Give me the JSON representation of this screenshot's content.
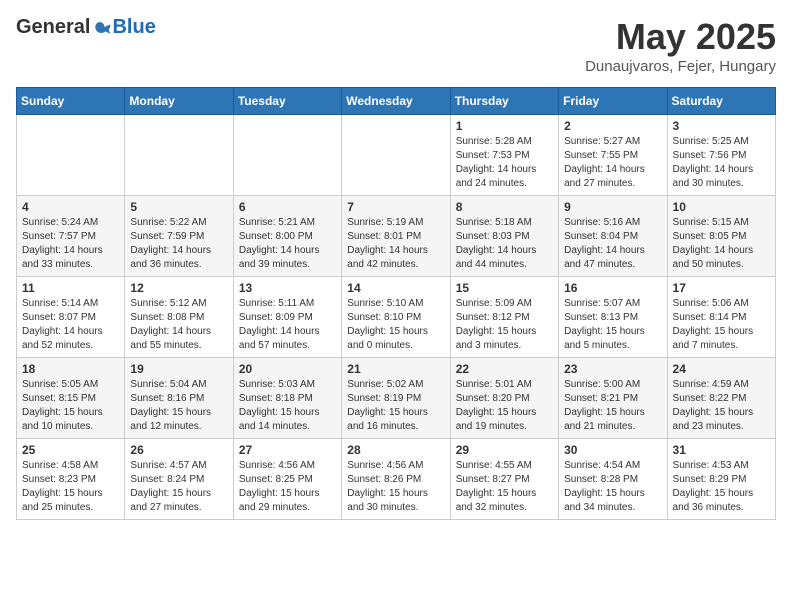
{
  "header": {
    "logo_general": "General",
    "logo_blue": "Blue",
    "title": "May 2025",
    "subtitle": "Dunaujvaros, Fejer, Hungary"
  },
  "weekdays": [
    "Sunday",
    "Monday",
    "Tuesday",
    "Wednesday",
    "Thursday",
    "Friday",
    "Saturday"
  ],
  "weeks": [
    [
      {
        "day": "",
        "sunrise": "",
        "sunset": "",
        "daylight": ""
      },
      {
        "day": "",
        "sunrise": "",
        "sunset": "",
        "daylight": ""
      },
      {
        "day": "",
        "sunrise": "",
        "sunset": "",
        "daylight": ""
      },
      {
        "day": "",
        "sunrise": "",
        "sunset": "",
        "daylight": ""
      },
      {
        "day": "1",
        "sunrise": "5:28 AM",
        "sunset": "7:53 PM",
        "daylight": "14 hours and 24 minutes."
      },
      {
        "day": "2",
        "sunrise": "5:27 AM",
        "sunset": "7:55 PM",
        "daylight": "14 hours and 27 minutes."
      },
      {
        "day": "3",
        "sunrise": "5:25 AM",
        "sunset": "7:56 PM",
        "daylight": "14 hours and 30 minutes."
      }
    ],
    [
      {
        "day": "4",
        "sunrise": "5:24 AM",
        "sunset": "7:57 PM",
        "daylight": "14 hours and 33 minutes."
      },
      {
        "day": "5",
        "sunrise": "5:22 AM",
        "sunset": "7:59 PM",
        "daylight": "14 hours and 36 minutes."
      },
      {
        "day": "6",
        "sunrise": "5:21 AM",
        "sunset": "8:00 PM",
        "daylight": "14 hours and 39 minutes."
      },
      {
        "day": "7",
        "sunrise": "5:19 AM",
        "sunset": "8:01 PM",
        "daylight": "14 hours and 42 minutes."
      },
      {
        "day": "8",
        "sunrise": "5:18 AM",
        "sunset": "8:03 PM",
        "daylight": "14 hours and 44 minutes."
      },
      {
        "day": "9",
        "sunrise": "5:16 AM",
        "sunset": "8:04 PM",
        "daylight": "14 hours and 47 minutes."
      },
      {
        "day": "10",
        "sunrise": "5:15 AM",
        "sunset": "8:05 PM",
        "daylight": "14 hours and 50 minutes."
      }
    ],
    [
      {
        "day": "11",
        "sunrise": "5:14 AM",
        "sunset": "8:07 PM",
        "daylight": "14 hours and 52 minutes."
      },
      {
        "day": "12",
        "sunrise": "5:12 AM",
        "sunset": "8:08 PM",
        "daylight": "14 hours and 55 minutes."
      },
      {
        "day": "13",
        "sunrise": "5:11 AM",
        "sunset": "8:09 PM",
        "daylight": "14 hours and 57 minutes."
      },
      {
        "day": "14",
        "sunrise": "5:10 AM",
        "sunset": "8:10 PM",
        "daylight": "15 hours and 0 minutes."
      },
      {
        "day": "15",
        "sunrise": "5:09 AM",
        "sunset": "8:12 PM",
        "daylight": "15 hours and 3 minutes."
      },
      {
        "day": "16",
        "sunrise": "5:07 AM",
        "sunset": "8:13 PM",
        "daylight": "15 hours and 5 minutes."
      },
      {
        "day": "17",
        "sunrise": "5:06 AM",
        "sunset": "8:14 PM",
        "daylight": "15 hours and 7 minutes."
      }
    ],
    [
      {
        "day": "18",
        "sunrise": "5:05 AM",
        "sunset": "8:15 PM",
        "daylight": "15 hours and 10 minutes."
      },
      {
        "day": "19",
        "sunrise": "5:04 AM",
        "sunset": "8:16 PM",
        "daylight": "15 hours and 12 minutes."
      },
      {
        "day": "20",
        "sunrise": "5:03 AM",
        "sunset": "8:18 PM",
        "daylight": "15 hours and 14 minutes."
      },
      {
        "day": "21",
        "sunrise": "5:02 AM",
        "sunset": "8:19 PM",
        "daylight": "15 hours and 16 minutes."
      },
      {
        "day": "22",
        "sunrise": "5:01 AM",
        "sunset": "8:20 PM",
        "daylight": "15 hours and 19 minutes."
      },
      {
        "day": "23",
        "sunrise": "5:00 AM",
        "sunset": "8:21 PM",
        "daylight": "15 hours and 21 minutes."
      },
      {
        "day": "24",
        "sunrise": "4:59 AM",
        "sunset": "8:22 PM",
        "daylight": "15 hours and 23 minutes."
      }
    ],
    [
      {
        "day": "25",
        "sunrise": "4:58 AM",
        "sunset": "8:23 PM",
        "daylight": "15 hours and 25 minutes."
      },
      {
        "day": "26",
        "sunrise": "4:57 AM",
        "sunset": "8:24 PM",
        "daylight": "15 hours and 27 minutes."
      },
      {
        "day": "27",
        "sunrise": "4:56 AM",
        "sunset": "8:25 PM",
        "daylight": "15 hours and 29 minutes."
      },
      {
        "day": "28",
        "sunrise": "4:56 AM",
        "sunset": "8:26 PM",
        "daylight": "15 hours and 30 minutes."
      },
      {
        "day": "29",
        "sunrise": "4:55 AM",
        "sunset": "8:27 PM",
        "daylight": "15 hours and 32 minutes."
      },
      {
        "day": "30",
        "sunrise": "4:54 AM",
        "sunset": "8:28 PM",
        "daylight": "15 hours and 34 minutes."
      },
      {
        "day": "31",
        "sunrise": "4:53 AM",
        "sunset": "8:29 PM",
        "daylight": "15 hours and 36 minutes."
      }
    ]
  ],
  "labels": {
    "sunrise": "Sunrise:",
    "sunset": "Sunset:",
    "daylight": "Daylight:"
  }
}
